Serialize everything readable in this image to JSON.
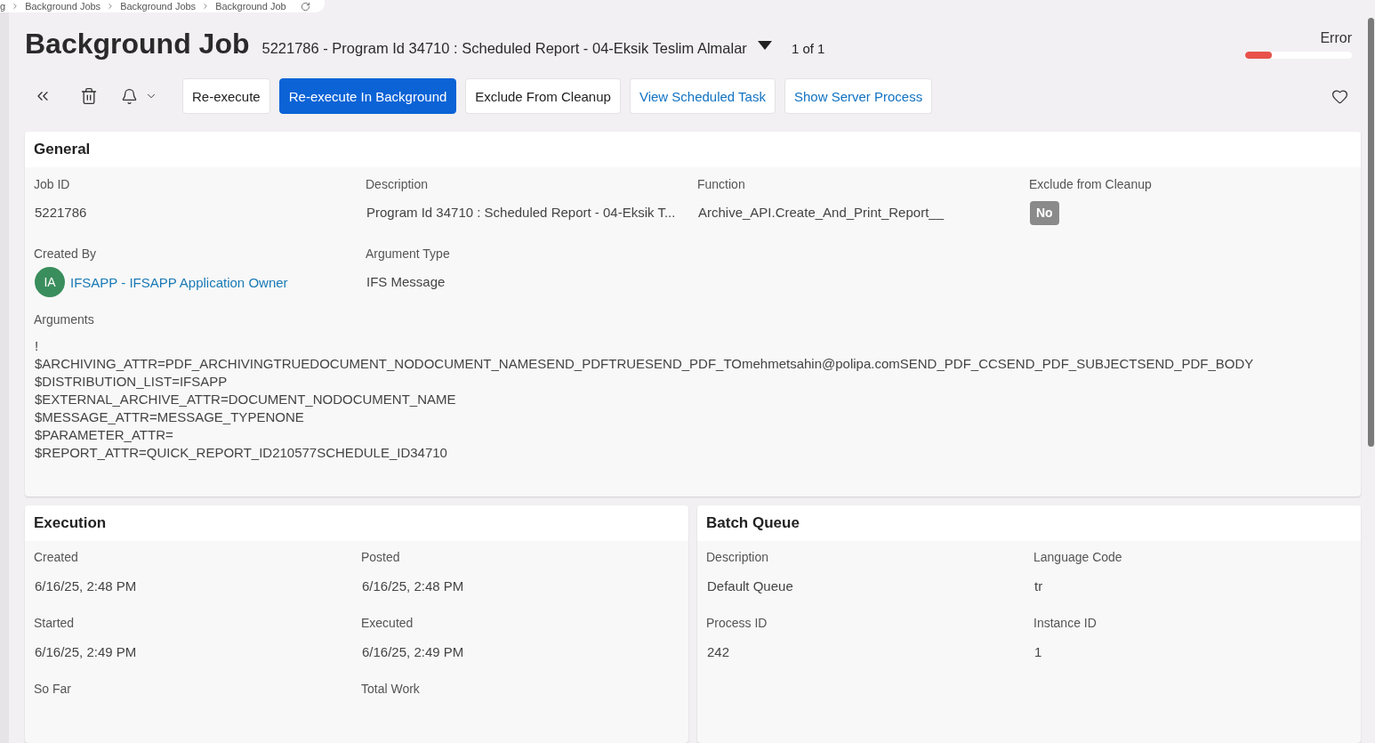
{
  "breadcrumb": {
    "items": [
      "g",
      "Background Jobs",
      "Background Jobs",
      "Background Job"
    ]
  },
  "header": {
    "title": "Background Job",
    "record": "5221786 - Program Id 34710 : Scheduled Report - 04-Eksik Teslim Almalar",
    "record_count": "1 of 1",
    "status": {
      "label": "Error",
      "level": 0.25
    }
  },
  "toolbar": {
    "buttons": [
      {
        "label": "Re-execute",
        "kind": "default"
      },
      {
        "label": "Re-execute In Background",
        "kind": "primary"
      },
      {
        "label": "Exclude From Cleanup",
        "kind": "default"
      },
      {
        "label": "View Scheduled Task",
        "kind": "link"
      },
      {
        "label": "Show Server Process",
        "kind": "link"
      }
    ]
  },
  "general": {
    "title": "General",
    "fields": [
      {
        "label": "Job ID",
        "value": "5221786",
        "kind": "text"
      },
      {
        "label": "Description",
        "value": "Program Id 34710 : Scheduled Report - 04-Eksik T...",
        "kind": "text"
      },
      {
        "label": "Function",
        "value": "Archive_API.Create_And_Print_Report__",
        "kind": "text"
      },
      {
        "label": "Exclude from Cleanup",
        "value": "No",
        "kind": "badge"
      },
      {
        "label": "Created By",
        "initials": "IA",
        "value": "IFSAPP - IFSAPP Application Owner",
        "kind": "user"
      },
      {
        "label": "Argument Type",
        "value": "IFS Message",
        "kind": "text"
      }
    ],
    "arguments": {
      "label": "Arguments",
      "lines": [
        "!",
        "$ARCHIVING_ATTR=PDF_ARCHIVINGTRUEDOCUMENT_NODOCUMENT_NAMESEND_PDFTRUESEND_PDF_TOmehmetsahin@polipa.comSEND_PDF_CCSEND_PDF_SUBJECTSEND_PDF_BODY",
        "$DISTRIBUTION_LIST=IFSAPP",
        "$EXTERNAL_ARCHIVE_ATTR=DOCUMENT_NODOCUMENT_NAME",
        "$MESSAGE_ATTR=MESSAGE_TYPENONE",
        "$PARAMETER_ATTR=",
        "$REPORT_ATTR=QUICK_REPORT_ID210577SCHEDULE_ID34710"
      ]
    }
  },
  "execution": {
    "title": "Execution",
    "fields": [
      {
        "label": "Created",
        "value": "6/16/25, 2:48 PM",
        "kind": "text"
      },
      {
        "label": "Posted",
        "value": "6/16/25, 2:48 PM",
        "kind": "text"
      },
      {
        "label": "Started",
        "value": "6/16/25, 2:49 PM",
        "kind": "text"
      },
      {
        "label": "Executed",
        "value": "6/16/25, 2:49 PM",
        "kind": "text"
      },
      {
        "label": "So Far",
        "kind": "empty"
      },
      {
        "label": "Total Work",
        "kind": "empty"
      }
    ]
  },
  "batch_queue": {
    "title": "Batch Queue",
    "fields": [
      {
        "label": "Description",
        "value": "Default Queue",
        "kind": "text"
      },
      {
        "label": "Language Code",
        "value": "tr",
        "kind": "text"
      },
      {
        "label": "Process ID",
        "value": "242",
        "kind": "text"
      },
      {
        "label": "Instance ID",
        "value": "1",
        "kind": "text"
      }
    ]
  }
}
